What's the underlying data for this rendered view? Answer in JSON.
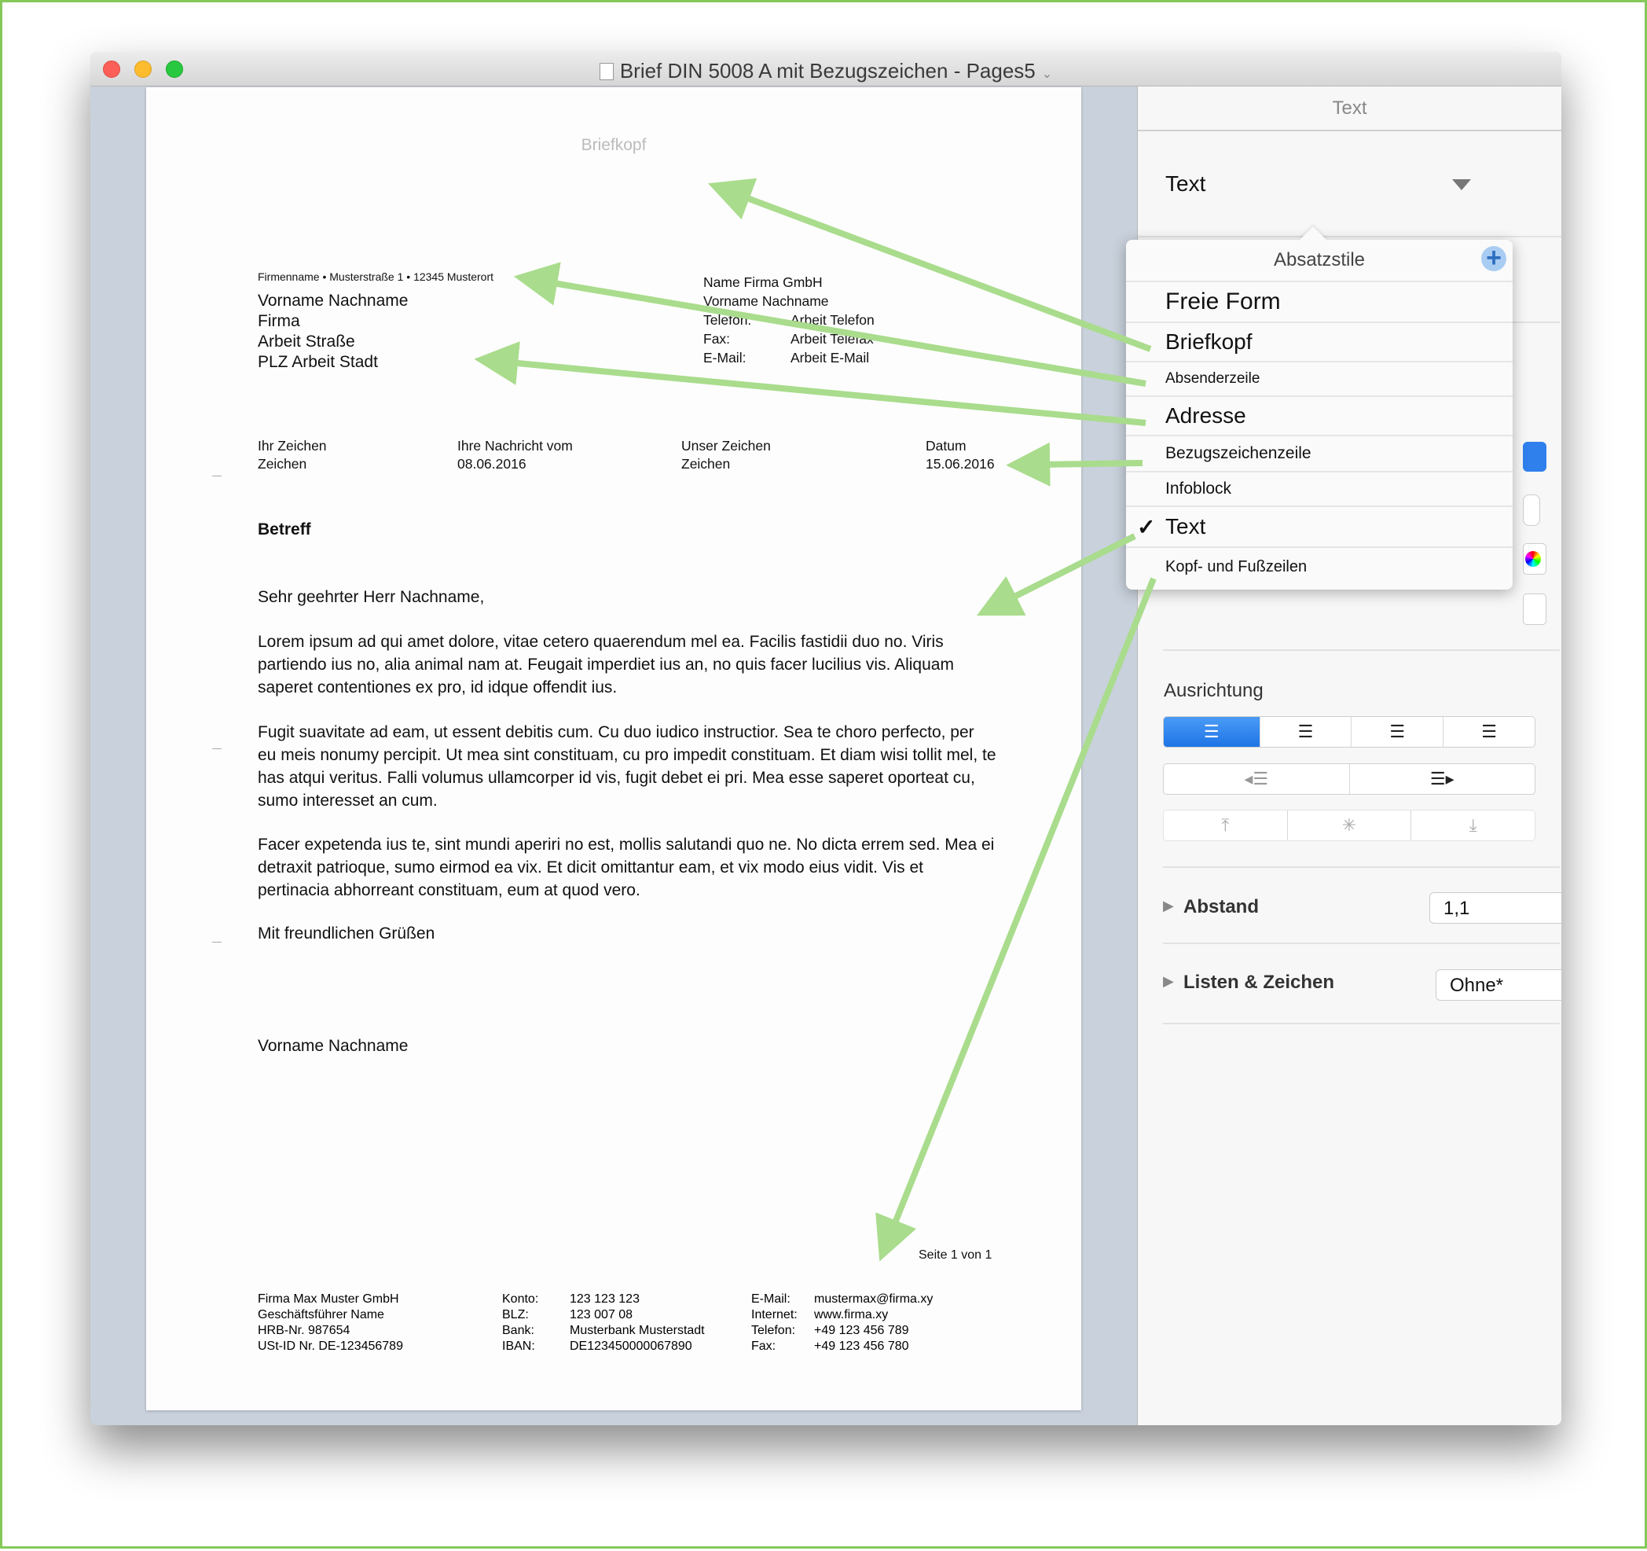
{
  "window": {
    "title": "Brief DIN 5008 A mit Bezugszeichen - Pages5"
  },
  "document": {
    "header_placeholder": "Briefkopf",
    "sender_line": "Firmenname • Musterstraße 1 • 12345 Musterort",
    "address": [
      "Vorname Nachname",
      "Firma",
      "Arbeit Straße",
      "PLZ Arbeit Stadt"
    ],
    "infoblock": {
      "company": "Name Firma GmbH",
      "name": "Vorname Nachname",
      "rows": [
        {
          "label": "Telefon:",
          "value": "Arbeit Telefon"
        },
        {
          "label": "Fax:",
          "value": "Arbeit Telefax"
        },
        {
          "label": "E-Mail:",
          "value": "Arbeit E-Mail"
        }
      ]
    },
    "reference": [
      {
        "label": "Ihr Zeichen",
        "value": "Zeichen"
      },
      {
        "label": "Ihre Nachricht vom",
        "value": "08.06.2016"
      },
      {
        "label": "Unser Zeichen",
        "value": "Zeichen"
      },
      {
        "label": "Datum",
        "value": "15.06.2016"
      }
    ],
    "subject": "Betreff",
    "salutation": "Sehr geehrter Herr Nachname,",
    "paragraphs": [
      "Lorem ipsum ad qui amet dolore, vitae cetero quaerendum mel ea. Facilis fastidii duo no. Viris partiendo ius no, alia animal nam at. Feugait imperdiet ius an, no quis facer lucilius vis. Aliquam saperet contentiones ex pro, id idque offendit ius.",
      "Fugit suavitate ad eam, ut essent debitis cum. Cu duo iudico instructior. Sea te choro perfecto, per eu meis nonumy percipit. Ut mea sint constituam, cu pro impedit constituam. Et diam wisi tollit mel, te has atqui veritus. Falli volumus ullamcorper id vis, fugit debet ei pri. Mea esse saperet oporteat cu, sumo interesset an cum.",
      "Facer expetenda ius te, sint mundi aperiri no est, mollis salutandi quo ne. No dicta errem sed. Mea ei detraxit patrioque, sumo eirmod ea vix. Et dicit omittantur eam, et vix modo eius vidit. Vis et pertinacia abhorreant constituam, eum at quod vero."
    ],
    "closing": "Mit freundlichen Grüßen",
    "signature": "Vorname Nachname",
    "page_number": "Seite 1 von 1",
    "footer": {
      "col1": [
        "Firma Max Muster GmbH",
        "Geschäftsführer Name",
        "HRB-Nr. 987654",
        "USt-ID Nr. DE-123456789"
      ],
      "col2_labels": [
        "Konto:",
        "BLZ:",
        "Bank:",
        "IBAN:"
      ],
      "col2_values": [
        "123 123 123",
        "123 007 08",
        "Musterbank Musterstadt",
        "DE123450000067890"
      ],
      "col3_labels": [
        "E-Mail:",
        "Internet:",
        "Telefon:",
        "Fax:"
      ],
      "col3_values": [
        "mustermax@firma.xy",
        "www.firma.xy",
        "+49 123 456 789",
        "+49 123 456 780"
      ]
    }
  },
  "sidebar": {
    "tab": "Text",
    "style_name": "Text",
    "popover": {
      "title": "Absatzstile",
      "items": [
        "Freie Form",
        "Briefkopf",
        "Absenderzeile",
        "Adresse",
        "Bezugszeichenzeile",
        "Infoblock",
        "Text",
        "Kopf- und Fußzeilen"
      ],
      "selected": "Text"
    },
    "alignment_label": "Ausrichtung",
    "alignment_selected": "left",
    "spacing_label": "Abstand",
    "spacing_value": "1,1",
    "lists_label": "Listen & Zeichen",
    "lists_value": "Ohne*"
  },
  "colors": {
    "accent": "#2f80ed",
    "annotation_arrow": "#a9dc8c",
    "frame": "#86c95a"
  }
}
